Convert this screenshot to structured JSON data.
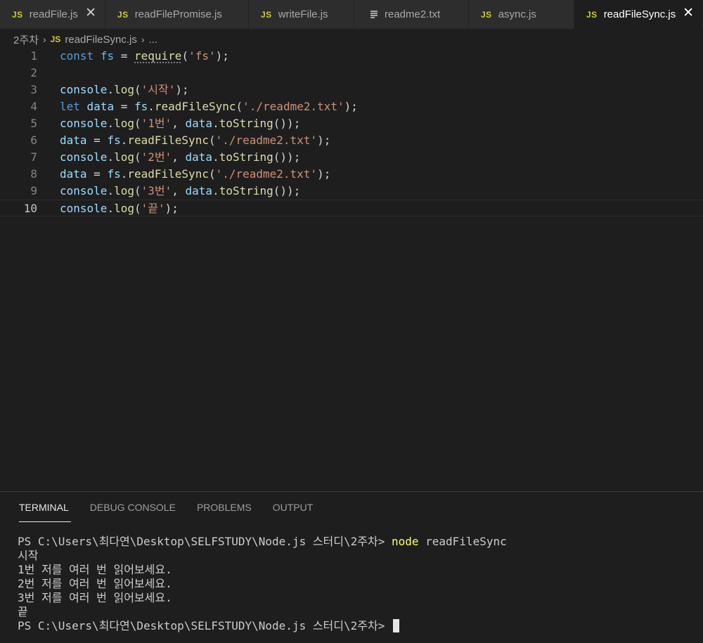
{
  "tabs": [
    {
      "label": "readFile.js",
      "type": "js",
      "close": "✕"
    },
    {
      "label": "readFilePromise.js",
      "type": "js"
    },
    {
      "label": "writeFile.js",
      "type": "js"
    },
    {
      "label": "readme2.txt",
      "type": "txt"
    },
    {
      "label": "async.js",
      "type": "js"
    },
    {
      "label": "readFileSync.js",
      "type": "js",
      "close": "✕",
      "active": true
    }
  ],
  "js_badge": "JS",
  "breadcrumb": {
    "folder": "2주차",
    "file": "readFileSync.js",
    "more": "..."
  },
  "editor": {
    "line_numbers": [
      "1",
      "2",
      "3",
      "4",
      "5",
      "6",
      "7",
      "8",
      "9",
      "10"
    ],
    "lines": [
      "const fs = require('fs');",
      "",
      "console.log('시작');",
      "let data = fs.readFileSync('./readme2.txt');",
      "console.log('1번', data.toString());",
      "data = fs.readFileSync('./readme2.txt');",
      "console.log('2번', data.toString());",
      "data = fs.readFileSync('./readme2.txt');",
      "console.log('3번', data.toString());",
      "console.log('끝');"
    ]
  },
  "panel": {
    "tabs": [
      "TERMINAL",
      "DEBUG CONSOLE",
      "PROBLEMS",
      "OUTPUT"
    ],
    "prompt": "PS C:\\Users\\최다연\\Desktop\\SELFSTUDY\\Node.js 스터디\\2주차> ",
    "command_name": "node",
    "command_arg": " readFileSync",
    "output": [
      "시작",
      "1번 저를 여러 번 읽어보세요.",
      "2번 저를 여러 번 읽어보세요.",
      "3번 저를 여러 번 읽어보세요.",
      "끝"
    ]
  },
  "colors": {
    "keyword": "#569cd6",
    "variable": "#9cdcfe",
    "function": "#dcdcaa",
    "string": "#ce9178",
    "js_icon": "#cbcb41",
    "terminal_command": "#ffff66"
  }
}
